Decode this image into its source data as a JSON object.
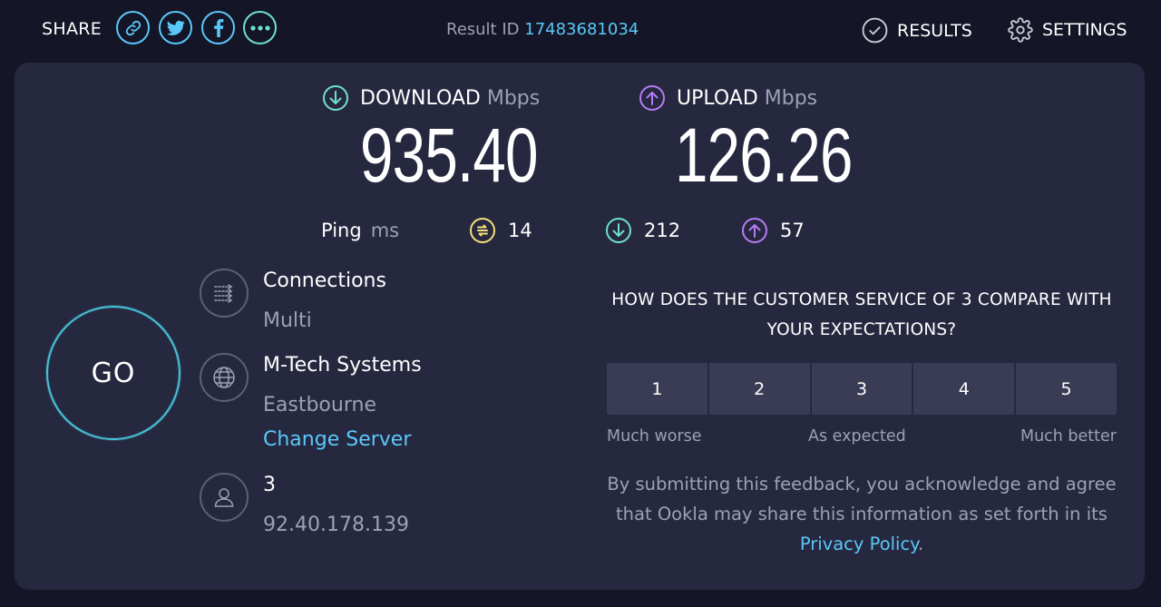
{
  "share": {
    "label": "SHARE"
  },
  "result": {
    "label": "Result ID",
    "id": "17483681034"
  },
  "nav": {
    "results_label": "RESULTS",
    "settings_label": "SETTINGS"
  },
  "download": {
    "label": "DOWNLOAD",
    "unit": "Mbps",
    "value": "935.40"
  },
  "upload": {
    "label": "UPLOAD",
    "unit": "Mbps",
    "value": "126.26"
  },
  "ping": {
    "label": "Ping",
    "unit": "ms",
    "idle": "14",
    "download": "212",
    "upload": "57"
  },
  "go": {
    "label": "GO"
  },
  "connections": {
    "title": "Connections",
    "value": "Multi"
  },
  "server": {
    "name": "M-Tech Systems",
    "location": "Eastbourne",
    "change_label": "Change Server"
  },
  "provider": {
    "name": "3",
    "ip": "92.40.178.139"
  },
  "survey": {
    "question": "HOW DOES THE CUSTOMER SERVICE OF 3 COMPARE WITH YOUR EXPECTATIONS?",
    "options": [
      "1",
      "2",
      "3",
      "4",
      "5"
    ],
    "caption_low": "Much worse",
    "caption_mid": "As expected",
    "caption_high": "Much better",
    "disclaimer": "By submitting this feedback, you acknowledge and agree that Ookla may share this information as set forth in its",
    "privacy_label": "Privacy Policy",
    "period": "."
  },
  "colors": {
    "background": "#141526",
    "card": "#26283f",
    "accent_blue": "#5ac8fa",
    "download": "#6fe0d0",
    "upload": "#b57cf5",
    "ping": "#f4e07a"
  }
}
